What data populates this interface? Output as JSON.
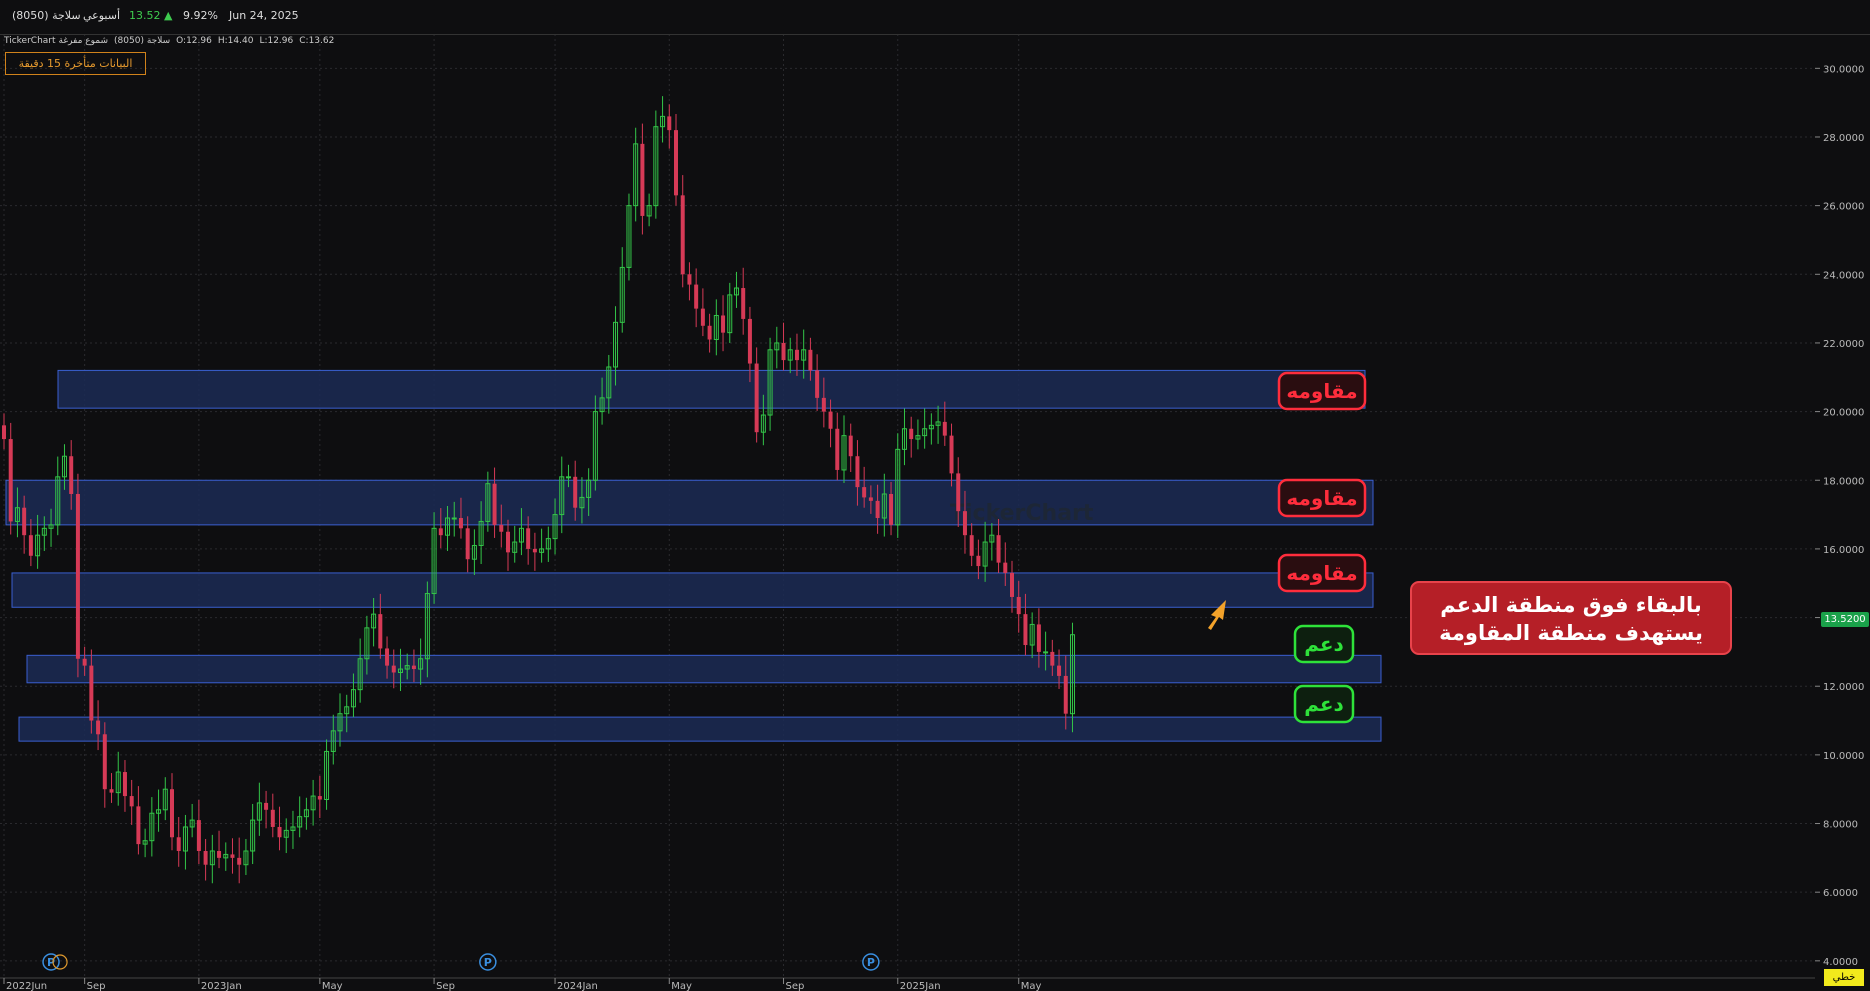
{
  "topbar": {
    "symbol": "سلاجة (8050)",
    "period": "أسبوعي",
    "price": "13.52",
    "change": "9.92%",
    "date": "Jun 24, 2025"
  },
  "info": {
    "source": "TickerChart",
    "symbol": "سلاجة (8050)",
    "chart_kind": "شموع مفرغة",
    "open": "O:12.96",
    "high": "H:14.40",
    "low": "L:12.96",
    "close": "C:13.62"
  },
  "delayed_notice": "البيانات متأخرة 15 دقيقة",
  "watermark": "TickerChart",
  "callout": {
    "line1": "بالبقاء فوق منطقة الدعم",
    "line2": "يستهدف منطقة المقاومة"
  },
  "last_price_tag": "13.5200",
  "line_button": "خطي",
  "zone_labels": {
    "resistance": "مقاومه",
    "support": "دعم"
  },
  "colors": {
    "up": "#33c548",
    "down": "#d63a56",
    "zone_fill": "#1b2a55",
    "zone_border": "#3a5fd0",
    "resistance": "#ff2d3c",
    "support": "#2ee23a",
    "arrow": "#f3a22a"
  },
  "chart_data": {
    "type": "candlestick",
    "y_range": [
      3.5,
      31
    ],
    "y_ticks": [
      "30.0000",
      "28.0000",
      "26.0000",
      "24.0000",
      "22.0000",
      "20.0000",
      "18.0000",
      "16.0000",
      "14.0000",
      "12.0000",
      "10.0000",
      "8.0000",
      "6.0000",
      "4.0000"
    ],
    "x_labels": [
      {
        "label": "2022Jun",
        "index": 0
      },
      {
        "label": "Sep",
        "index": 12
      },
      {
        "label": "2023Jan",
        "index": 29
      },
      {
        "label": "May",
        "index": 47
      },
      {
        "label": "Sep",
        "index": 64
      },
      {
        "label": "2024Jan",
        "index": 82
      },
      {
        "label": "May",
        "index": 99
      },
      {
        "label": "Sep",
        "index": 116
      },
      {
        "label": "2025Jan",
        "index": 133
      },
      {
        "label": "May",
        "index": 151
      }
    ],
    "zones": [
      {
        "type": "resistance",
        "low": 20.1,
        "high": 21.2
      },
      {
        "type": "resistance",
        "low": 16.7,
        "high": 18.0
      },
      {
        "type": "resistance",
        "low": 14.3,
        "high": 15.3
      },
      {
        "type": "support",
        "low": 12.1,
        "high": 12.9
      },
      {
        "type": "support",
        "low": 10.4,
        "high": 11.1
      }
    ],
    "pivot_markers": [
      7,
      72,
      129
    ],
    "close": [
      19.2,
      16.8,
      17.2,
      16.4,
      15.8,
      16.4,
      16.6,
      16.7,
      18.1,
      18.7,
      17.6,
      12.8,
      12.6,
      11.0,
      10.6,
      9.0,
      8.9,
      9.5,
      8.8,
      8.5,
      7.4,
      7.5,
      8.3,
      8.4,
      9.0,
      7.6,
      7.2,
      7.9,
      8.1,
      7.2,
      6.8,
      7.2,
      7.0,
      7.1,
      7.0,
      6.8,
      7.2,
      8.1,
      8.6,
      8.4,
      7.9,
      7.6,
      7.8,
      7.9,
      8.2,
      8.4,
      8.8,
      8.7,
      10.1,
      10.7,
      11.2,
      11.4,
      11.9,
      12.8,
      13.7,
      14.1,
      13.1,
      12.6,
      12.4,
      12.5,
      12.6,
      12.5,
      12.8,
      14.7,
      16.6,
      16.4,
      16.9,
      16.9,
      16.6,
      15.7,
      16.1,
      16.8,
      17.9,
      16.7,
      16.5,
      15.9,
      16.2,
      16.6,
      16.0,
      15.9,
      16.0,
      16.3,
      17.0,
      18.1,
      18.1,
      17.2,
      17.5,
      18.0,
      20.0,
      20.4,
      21.3,
      22.6,
      24.2,
      26.0,
      27.8,
      25.7,
      26.0,
      28.3,
      28.6,
      28.2,
      26.3,
      24.0,
      23.7,
      23.0,
      22.5,
      22.1,
      22.8,
      22.3,
      23.4,
      23.6,
      22.7,
      21.4,
      19.4,
      19.9,
      21.8,
      22.0,
      21.5,
      21.8,
      21.5,
      21.8,
      21.2,
      20.4,
      20.0,
      19.5,
      18.3,
      19.3,
      18.7,
      17.8,
      17.5,
      17.4,
      16.9,
      17.6,
      16.7,
      18.9,
      19.5,
      19.2,
      19.3,
      19.5,
      19.6,
      19.7,
      19.3,
      18.2,
      17.1,
      16.4,
      15.8,
      15.5,
      16.2,
      16.4,
      15.6,
      15.3,
      14.6,
      14.1,
      13.2,
      13.8,
      13.0,
      13.0,
      12.6,
      12.3,
      11.2,
      13.5
    ]
  }
}
